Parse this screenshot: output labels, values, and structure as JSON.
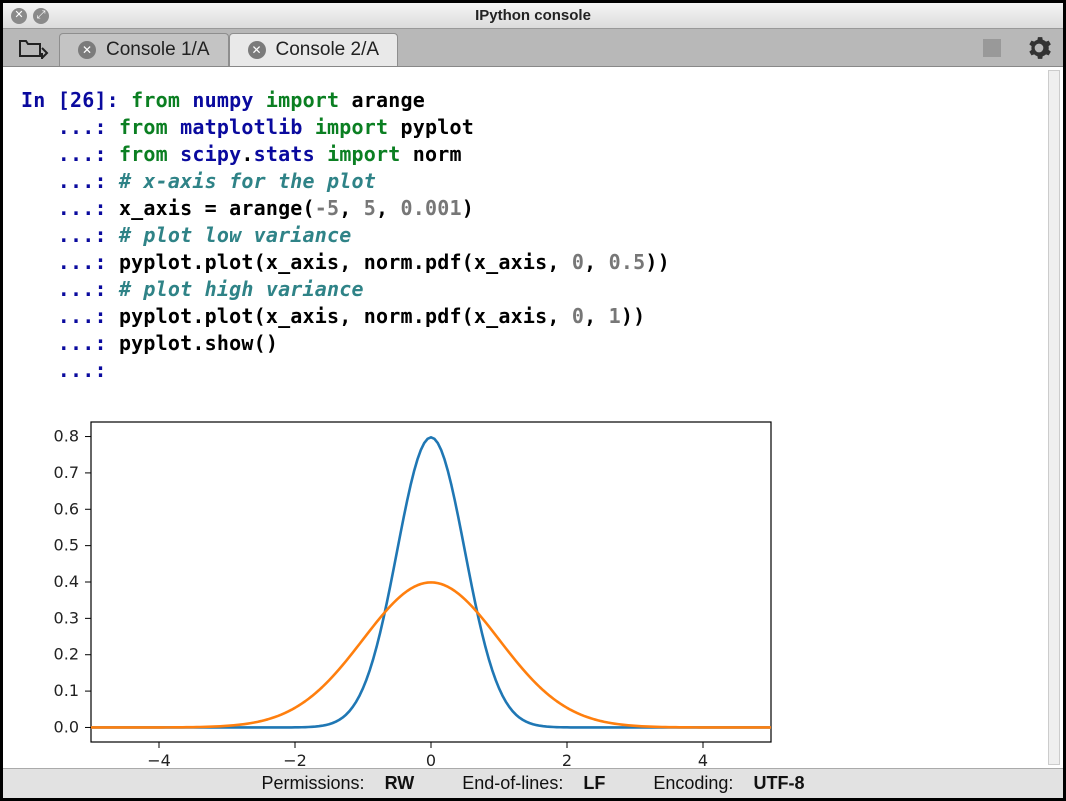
{
  "window": {
    "title": "IPython console"
  },
  "tabs": [
    {
      "label": "Console 1/A",
      "active": false
    },
    {
      "label": "Console 2/A",
      "active": true
    }
  ],
  "code": {
    "prompt": "In [26]: ",
    "cont": "   ...: ",
    "lines": [
      {
        "seg": [
          {
            "t": "from ",
            "c": "kw-green"
          },
          {
            "t": "numpy ",
            "c": "kw-blue"
          },
          {
            "t": "import ",
            "c": "kw-green"
          },
          {
            "t": "arange",
            "c": ""
          }
        ]
      },
      {
        "seg": [
          {
            "t": "from ",
            "c": "kw-green"
          },
          {
            "t": "matplotlib ",
            "c": "kw-blue"
          },
          {
            "t": "import ",
            "c": "kw-green"
          },
          {
            "t": "pyplot",
            "c": ""
          }
        ]
      },
      {
        "seg": [
          {
            "t": "from ",
            "c": "kw-green"
          },
          {
            "t": "scipy",
            "c": "kw-blue"
          },
          {
            "t": ".",
            "c": ""
          },
          {
            "t": "stats ",
            "c": "kw-blue"
          },
          {
            "t": "import ",
            "c": "kw-green"
          },
          {
            "t": "norm",
            "c": ""
          }
        ]
      },
      {
        "seg": [
          {
            "t": "# x-axis for the plot",
            "c": "comment"
          }
        ]
      },
      {
        "seg": [
          {
            "t": "x_axis ",
            "c": ""
          },
          {
            "t": "=",
            "c": ""
          },
          {
            "t": " arange(",
            "c": ""
          },
          {
            "t": "-5",
            "c": "num"
          },
          {
            "t": ", ",
            "c": ""
          },
          {
            "t": "5",
            "c": "num"
          },
          {
            "t": ", ",
            "c": ""
          },
          {
            "t": "0.001",
            "c": "num"
          },
          {
            "t": ")",
            "c": ""
          }
        ]
      },
      {
        "seg": [
          {
            "t": "# plot low variance",
            "c": "comment"
          }
        ]
      },
      {
        "seg": [
          {
            "t": "pyplot",
            "c": ""
          },
          {
            "t": ".",
            "c": ""
          },
          {
            "t": "plot(x_axis, norm",
            "c": ""
          },
          {
            "t": ".",
            "c": ""
          },
          {
            "t": "pdf(x_axis, ",
            "c": ""
          },
          {
            "t": "0",
            "c": "num"
          },
          {
            "t": ", ",
            "c": ""
          },
          {
            "t": "0.5",
            "c": "num"
          },
          {
            "t": "))",
            "c": ""
          }
        ]
      },
      {
        "seg": [
          {
            "t": "# plot high variance",
            "c": "comment"
          }
        ]
      },
      {
        "seg": [
          {
            "t": "pyplot",
            "c": ""
          },
          {
            "t": ".",
            "c": ""
          },
          {
            "t": "plot(x_axis, norm",
            "c": ""
          },
          {
            "t": ".",
            "c": ""
          },
          {
            "t": "pdf(x_axis, ",
            "c": ""
          },
          {
            "t": "0",
            "c": "num"
          },
          {
            "t": ", ",
            "c": ""
          },
          {
            "t": "1",
            "c": "num"
          },
          {
            "t": "))",
            "c": ""
          }
        ]
      },
      {
        "seg": [
          {
            "t": "pyplot",
            "c": ""
          },
          {
            "t": ".",
            "c": ""
          },
          {
            "t": "show()",
            "c": ""
          }
        ]
      },
      {
        "seg": []
      }
    ]
  },
  "chart_data": {
    "type": "line",
    "x": {
      "from": -5,
      "to": 5,
      "step": 0.05
    },
    "series": [
      {
        "name": "norm.pdf(x, 0, 0.5)",
        "mean": 0,
        "sigma": 0.5,
        "color": "#1f77b4"
      },
      {
        "name": "norm.pdf(x, 0, 1)",
        "mean": 0,
        "sigma": 1.0,
        "color": "#ff7f0e"
      }
    ],
    "xticks": [
      -4,
      -2,
      0,
      2,
      4
    ],
    "yticks": [
      0.0,
      0.1,
      0.2,
      0.3,
      0.4,
      0.5,
      0.6,
      0.7,
      0.8
    ],
    "xlim": [
      -5,
      5
    ],
    "ylim": [
      -0.04,
      0.84
    ]
  },
  "status": {
    "permissions_label": "Permissions:",
    "permissions_value": "RW",
    "eol_label": "End-of-lines:",
    "eol_value": "LF",
    "encoding_label": "Encoding:",
    "encoding_value": "UTF-8"
  }
}
